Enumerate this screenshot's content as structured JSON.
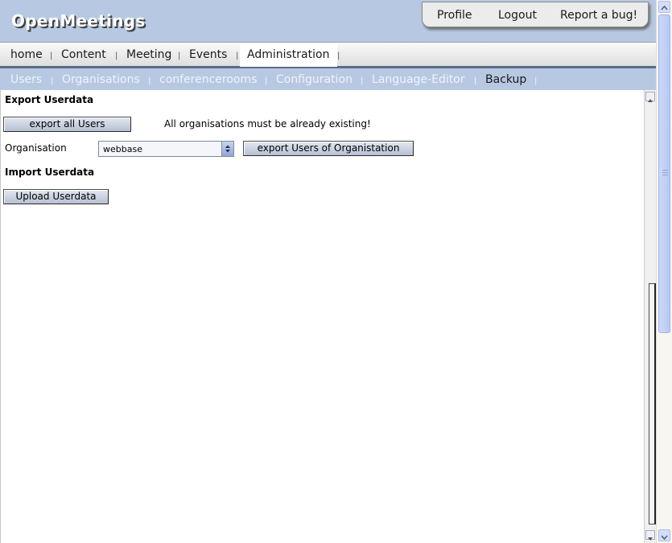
{
  "app": {
    "title": "OpenMeetings"
  },
  "user_menu": {
    "items": [
      "Profile",
      "Logout",
      "Report a bug!"
    ]
  },
  "main_nav": {
    "items": [
      "home",
      "Content",
      "Meeting",
      "Events",
      "Administration"
    ],
    "active": "Administration",
    "separator": "|"
  },
  "sub_nav": {
    "items": [
      "Users",
      "Organisations",
      "conferencerooms",
      "Configuration",
      "Language-Editor",
      "Backup"
    ],
    "active": "Backup",
    "separator": "|"
  },
  "export": {
    "title": "Export Userdata",
    "export_all_label": "export all Users",
    "notice": "All organisations must be already existing!",
    "organisation_label": "Organisation",
    "organisation_value": "webbase",
    "export_org_label": "export Users of Organistation"
  },
  "import": {
    "title": "Import Userdata",
    "upload_label": "Upload Userdata"
  },
  "colors": {
    "header_bg": "#b7c9e2",
    "nav_underline": "#596b88",
    "button_top": "#e3e8f1",
    "button_bottom": "#b6c0d3"
  }
}
